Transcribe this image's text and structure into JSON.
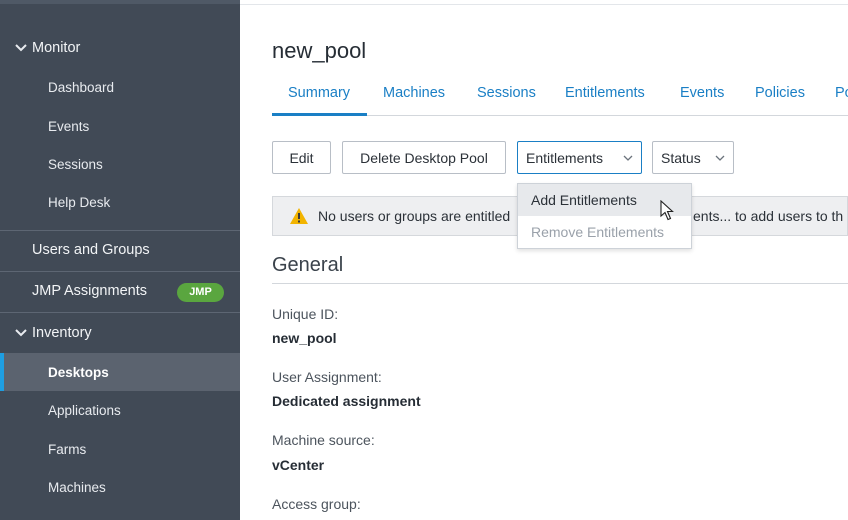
{
  "sidebar": {
    "monitor_label": "Monitor",
    "monitor_items": [
      "Dashboard",
      "Events",
      "Sessions",
      "Help Desk"
    ],
    "users_groups_label": "Users and Groups",
    "jmp_label": "JMP Assignments",
    "jmp_badge": "JMP",
    "inventory_label": "Inventory",
    "inventory_items": [
      "Desktops",
      "Applications",
      "Farms",
      "Machines"
    ],
    "active_item": "Desktops"
  },
  "main": {
    "title": "new_pool",
    "tabs": [
      "Summary",
      "Machines",
      "Sessions",
      "Entitlements",
      "Events",
      "Policies",
      "Po"
    ],
    "active_tab": "Summary",
    "buttons": {
      "edit": "Edit",
      "delete": "Delete Desktop Pool",
      "entitlements": "Entitlements",
      "status": "Status"
    },
    "alert": {
      "text_left": "No users or groups are entitled",
      "text_right": "ents... to add users to th"
    },
    "menu": {
      "items": [
        "Add Entitlements",
        "Remove Entitlements"
      ]
    },
    "section_title": "General",
    "fields": [
      {
        "label": "Unique ID:",
        "value": "new_pool"
      },
      {
        "label": "User Assignment:",
        "value": "Dedicated assignment"
      },
      {
        "label": "Machine source:",
        "value": "vCenter"
      },
      {
        "label": "Access group:",
        "value": ""
      }
    ]
  },
  "colors": {
    "sidebar_bg": "#414a56",
    "accent": "#1a7fc5",
    "badge_green": "#5aa63f",
    "warning": "#f2b400"
  }
}
